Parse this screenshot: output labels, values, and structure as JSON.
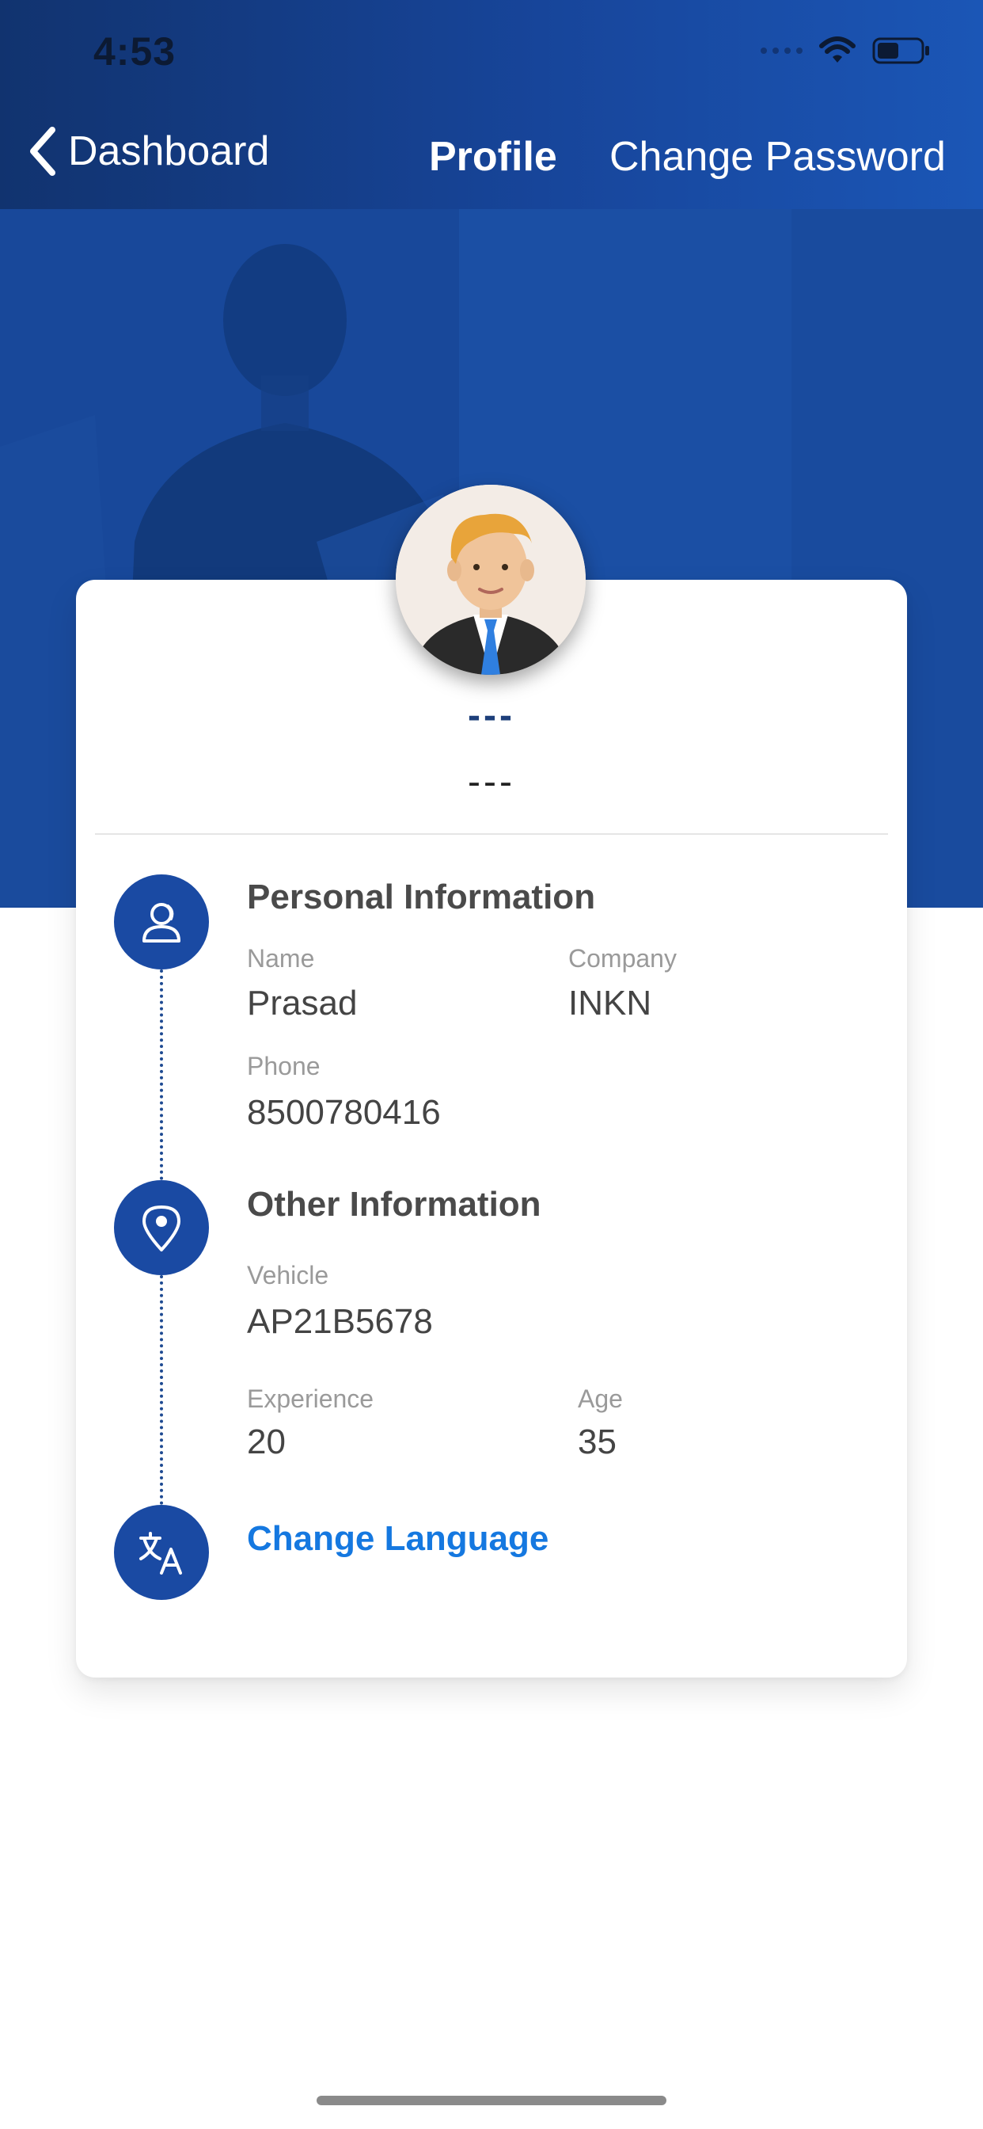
{
  "status_bar": {
    "time": "4:53",
    "icons": [
      "signal-dots-icon",
      "wifi-icon",
      "battery-icon"
    ]
  },
  "nav": {
    "back_label": "Dashboard",
    "back_icon": "chevron-left-icon",
    "tabs": [
      {
        "label": "Profile",
        "active": true
      },
      {
        "label": "Change Password",
        "active": false
      }
    ]
  },
  "profile": {
    "name": "---",
    "subtitle": "---",
    "avatar_icon": "avatar-man-icon"
  },
  "personal_information": {
    "title": "Personal Information",
    "icon": "user-profile-icon",
    "name_label": "Name",
    "name_value": "Prasad",
    "company_label": "Company",
    "company_value": "INKN",
    "phone_label": "Phone",
    "phone_value": "8500780416"
  },
  "other_information": {
    "title": "Other Information",
    "icon": "location-pin-icon",
    "vehicle_label": "Vehicle",
    "vehicle_value": "AP21B5678",
    "experience_label": "Experience",
    "experience_value": "20",
    "age_label": "Age",
    "age_value": "35"
  },
  "language": {
    "label": "Change Language",
    "icon": "translate-icon"
  },
  "colors": {
    "header_blue": "#17459a",
    "icon_circle": "#1a4aa3",
    "link": "#1578e0",
    "name_text": "#1d3f7a"
  }
}
